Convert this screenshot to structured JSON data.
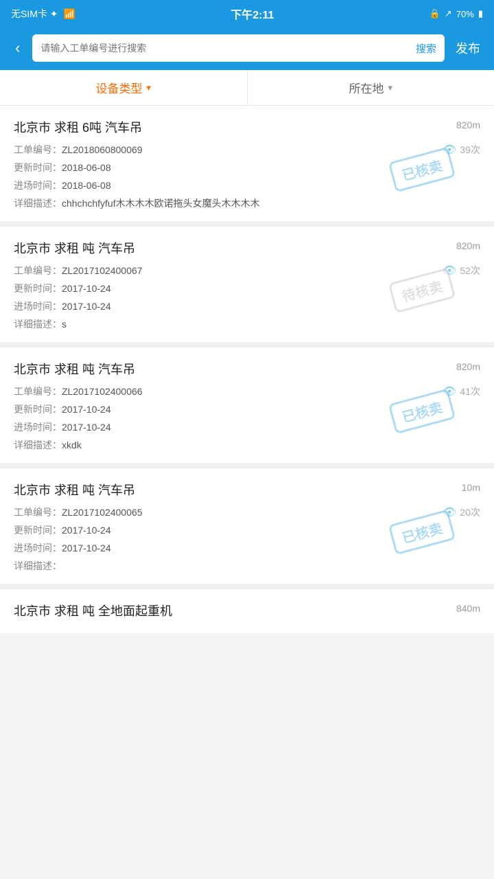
{
  "statusBar": {
    "left": "无SIM卡 ✦",
    "center": "下午2:11",
    "battery": "70%",
    "lock_icon": "🔒",
    "arrow_icon": "↗"
  },
  "header": {
    "back_label": "‹",
    "search_placeholder": "请输入工单编号进行搜索",
    "search_btn": "搜索",
    "publish_btn": "发布"
  },
  "filters": {
    "type_label": "设备类型",
    "location_label": "所在地"
  },
  "items": [
    {
      "title": "北京市 求租 6吨 汽车吊",
      "distance": "820m",
      "order_no": "ZL2018060800069",
      "views": "39次",
      "update_time": "2018-06-08",
      "entry_time": "2018-06-08",
      "description": "chhchchfyfuf木木木木欧诺拖头女魔头木木木木",
      "stamp": "已核卖",
      "stamp_type": "sold"
    },
    {
      "title": "北京市 求租 吨 汽车吊",
      "distance": "820m",
      "order_no": "ZL2017102400067",
      "views": "52次",
      "update_time": "2017-10-24",
      "entry_time": "2017-10-24",
      "description": "s",
      "stamp": "待核卖",
      "stamp_type": "pending"
    },
    {
      "title": "北京市 求租 吨 汽车吊",
      "distance": "820m",
      "order_no": "ZL2017102400066",
      "views": "41次",
      "update_time": "2017-10-24",
      "entry_time": "2017-10-24",
      "description": "xkdk",
      "stamp": "已核卖",
      "stamp_type": "sold"
    },
    {
      "title": "北京市 求租 吨 汽车吊",
      "distance": "10m",
      "order_no": "ZL2017102400065",
      "views": "20次",
      "update_time": "2017-10-24",
      "entry_time": "2017-10-24",
      "description": "",
      "stamp": "已核卖",
      "stamp_type": "sold"
    },
    {
      "title": "北京市 求租 吨 全地面起重机",
      "distance": "840m",
      "order_no": "",
      "views": "",
      "update_time": "",
      "entry_time": "",
      "description": "",
      "stamp": "",
      "stamp_type": "none"
    }
  ],
  "labels": {
    "order_prefix": "工单编号：",
    "update_prefix": "更新时间：",
    "entry_prefix": "进场时间：",
    "desc_prefix": "详细描述："
  }
}
